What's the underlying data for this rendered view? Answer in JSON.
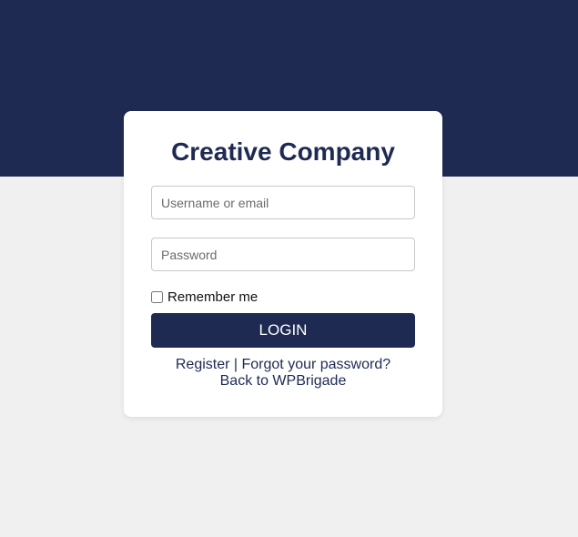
{
  "form": {
    "title": "Creative Company",
    "username_placeholder": "Username or email",
    "password_placeholder": "Password",
    "remember_label": "Remember me",
    "login_label": "LOGIN"
  },
  "links": {
    "register": "Register",
    "separator": "|",
    "forgot": "Forgot your password?",
    "back": "Back to WPBrigade"
  },
  "colors": {
    "brand": "#1f2a52",
    "background": "#f0f0f0",
    "card": "#ffffff"
  }
}
